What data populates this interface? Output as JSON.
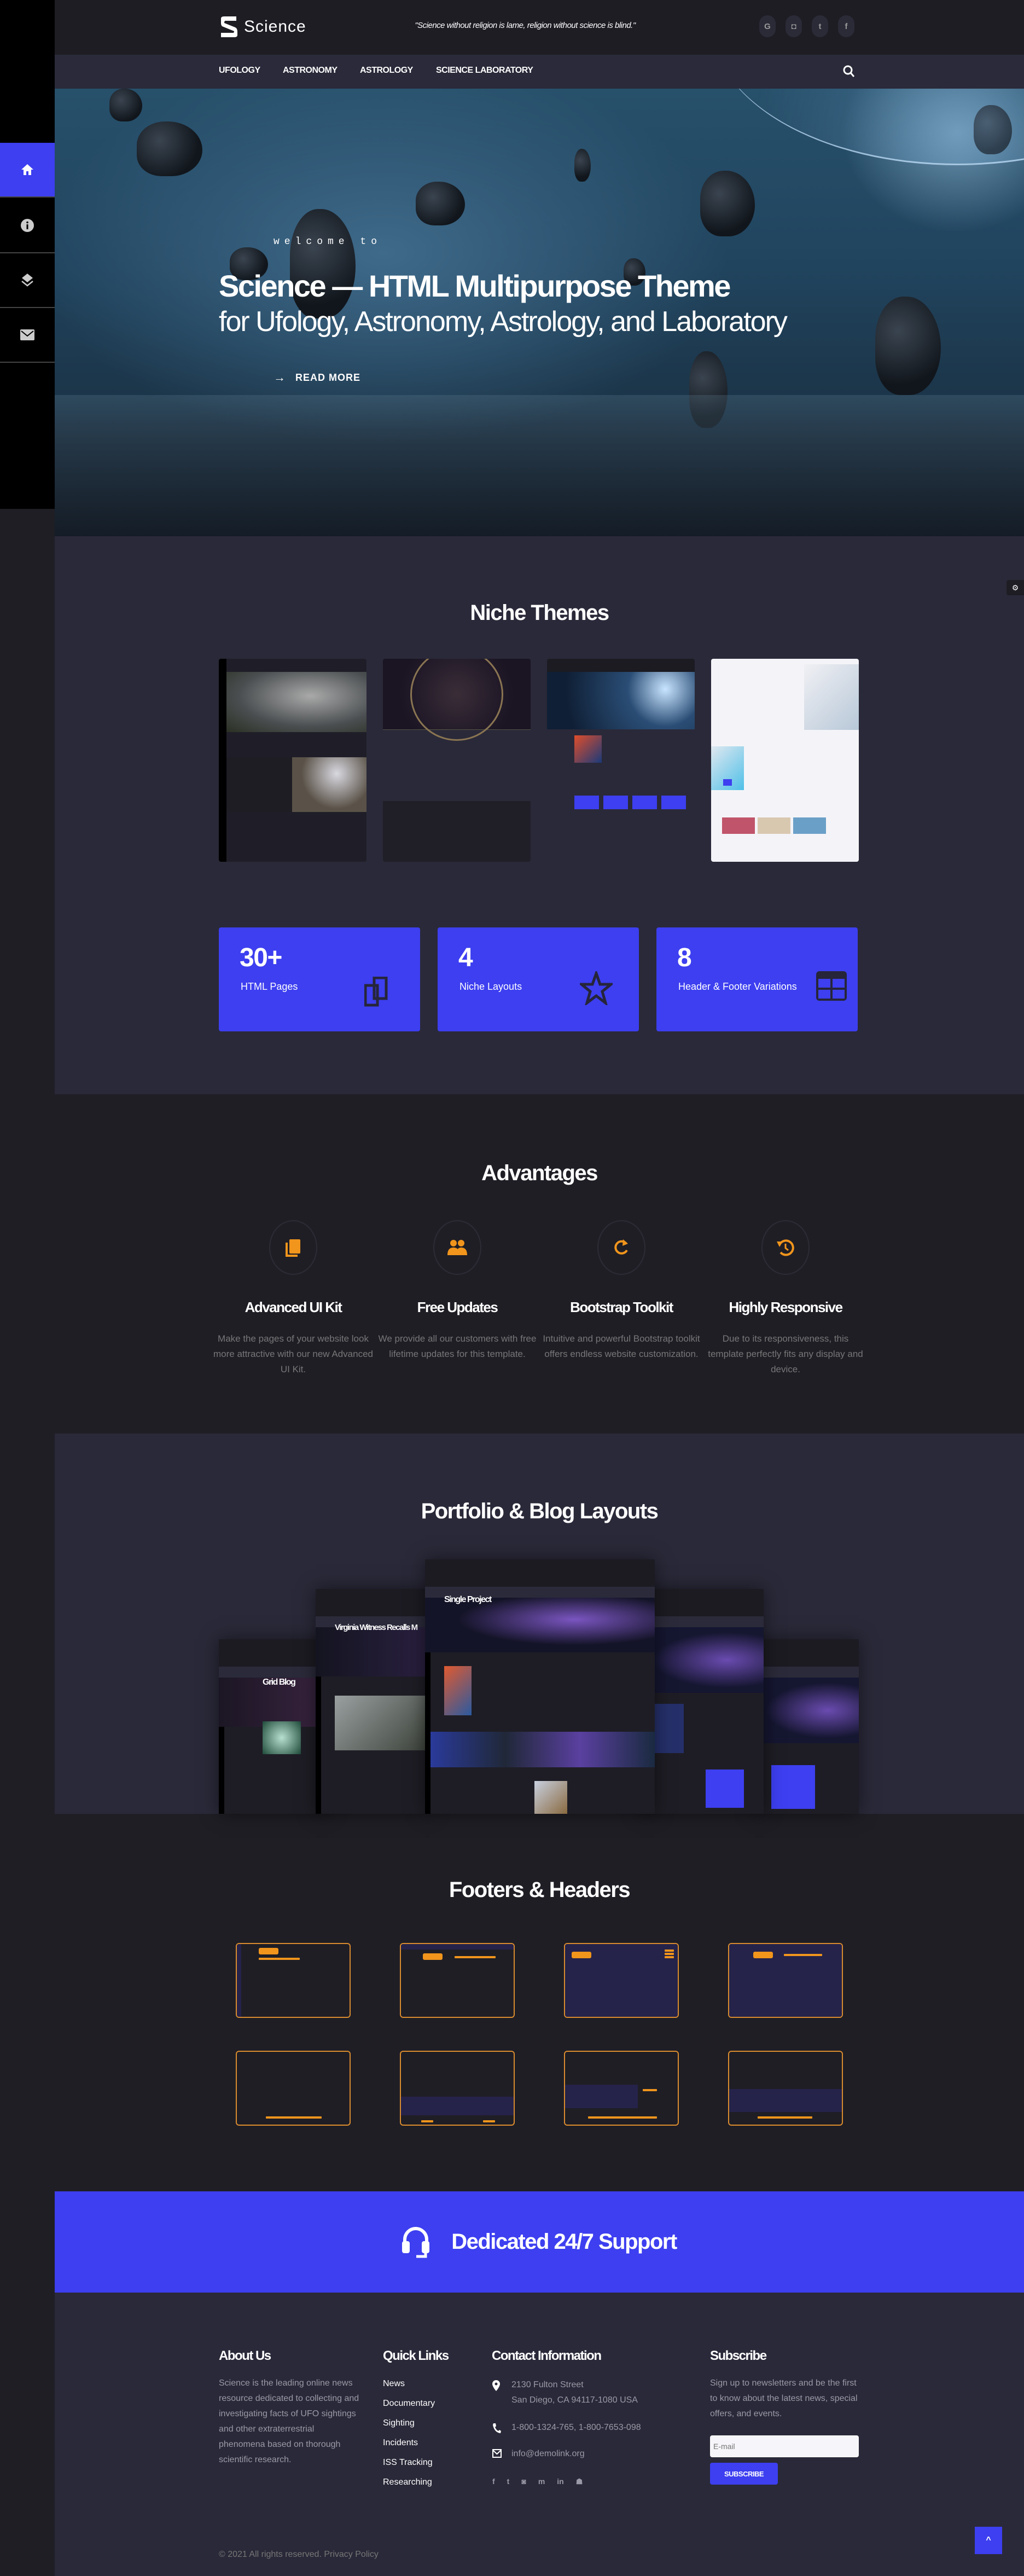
{
  "colors": {
    "accent": "#3d3ff0",
    "orange": "#f1951c",
    "bg_dark": "#1f1e25",
    "bg_mid": "#2a2939"
  },
  "sidebar": {
    "items": [
      {
        "icon": "home-icon",
        "active": true
      },
      {
        "icon": "info-icon"
      },
      {
        "icon": "layers-icon"
      },
      {
        "icon": "mail-icon"
      }
    ]
  },
  "header": {
    "logo_text": "Science",
    "quote": "\"Science without religion is lame, religion without science is blind.\"",
    "social": [
      "G",
      "◘",
      "t",
      "f"
    ]
  },
  "nav": {
    "items": [
      "UFOLOGY",
      "ASTRONOMY",
      "ASTROLOGY",
      "SCIENCE LABORATORY"
    ]
  },
  "hero": {
    "kicker": "welcome to",
    "title": "Science — HTML Multipurpose Theme",
    "subtitle": "for Ufology, Astronomy, Astrology, and Laboratory",
    "cta": "READ MORE"
  },
  "niche": {
    "title": "Niche Themes",
    "stats": [
      {
        "value": "30+",
        "label": "HTML Pages",
        "icon": "copy-icon"
      },
      {
        "value": "4",
        "label": "Niche Layouts",
        "icon": "star-icon"
      },
      {
        "value": "8",
        "label": "Header & Footer Variations",
        "icon": "table-icon"
      }
    ]
  },
  "advantages": {
    "title": "Advantages",
    "items": [
      {
        "title": "Advanced UI Kit",
        "text": "Make the pages of your website look more attractive with our new Advanced UI Kit.",
        "icon": "book-icon"
      },
      {
        "title": "Free Updates",
        "text": "We provide all our customers with free lifetime updates for this template.",
        "icon": "users-icon"
      },
      {
        "title": "Bootstrap Toolkit",
        "text": "Intuitive and powerful Bootstrap toolkit offers endless website customization.",
        "icon": "refresh-icon"
      },
      {
        "title": "Highly Responsive",
        "text": "Due to its responsiveness, this template perfectly fits any display and device.",
        "icon": "history-icon"
      }
    ]
  },
  "portfolio": {
    "title": "Portfolio & Blog Layouts",
    "shots": [
      "Grid Blog",
      "Virginia Witness Recalls M",
      "Single Project"
    ]
  },
  "footers_headers": {
    "title": "Footers & Headers"
  },
  "support": {
    "title": "Dedicated 24/7 Support"
  },
  "footer": {
    "about": {
      "title": "About Us",
      "text": "Science is the leading online news resource dedicated to collecting and investigating facts of UFO sightings and other extraterrestrial phenomena based on thorough scientific research."
    },
    "quick": {
      "title": "Quick Links",
      "links": [
        "News",
        "Documentary",
        "Sighting",
        "Incidents",
        "ISS Tracking",
        "Researching"
      ]
    },
    "contact": {
      "title": "Contact Information",
      "address1": "2130 Fulton Street",
      "address2": "San Diego, CA 94117-1080 USA",
      "phone": "1-800-1324-765, 1-800-7653-098",
      "email": "info@demolink.org",
      "social": [
        "f",
        "t",
        "◙",
        "m",
        "in",
        "☗"
      ]
    },
    "subscribe": {
      "title": "Subscribe",
      "text": "Sign up to newsletters and be the first to know about the latest news, special offers, and events.",
      "placeholder": "E-mail",
      "button": "SUBSCRIBE"
    },
    "copyright": "© 2021 All rights reserved.",
    "privacy": "Privacy Policy",
    "back_to_top": "^"
  }
}
